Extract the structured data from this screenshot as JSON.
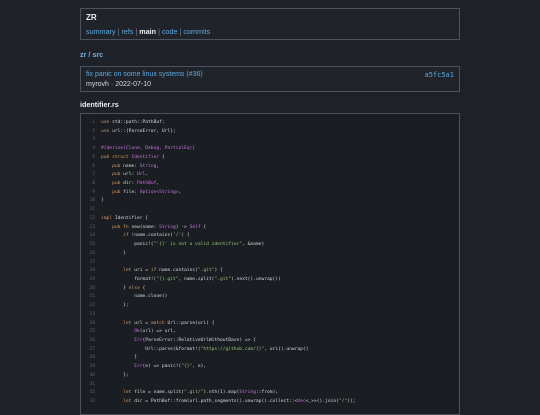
{
  "repo": {
    "name": "ZR",
    "nav": [
      {
        "label": "summary",
        "active": false
      },
      {
        "label": "refs",
        "active": false
      },
      {
        "label": "main",
        "active": true
      },
      {
        "label": "code",
        "active": false
      },
      {
        "label": "commits",
        "active": false
      }
    ],
    "nav_separator": " | "
  },
  "breadcrumb": "zr / src",
  "commit": {
    "message": "fix panic on some linux systems (#36)",
    "author": "myrovh",
    "date": "2022-07-10",
    "separator": " · ",
    "hash": "a5fc5a1"
  },
  "file": {
    "name": "identifier.rs",
    "lines": [
      [
        [
          "kw",
          "use "
        ],
        [
          "txt",
          "std::path::PathBuf;"
        ]
      ],
      [
        [
          "kw",
          "use "
        ],
        [
          "txt",
          "url::{ParseError, Url};"
        ]
      ],
      [],
      [
        [
          "attr",
          "#[derive(Clone, Debug, PartialEq)]"
        ]
      ],
      [
        [
          "kw",
          "pub struct "
        ],
        [
          "ty",
          "Identifier"
        ],
        [
          "txt",
          " {"
        ]
      ],
      [
        [
          "txt",
          "    "
        ],
        [
          "kw",
          "pub "
        ],
        [
          "txt",
          "name: "
        ],
        [
          "ty",
          "String"
        ],
        [
          "txt",
          ","
        ]
      ],
      [
        [
          "txt",
          "    "
        ],
        [
          "kw",
          "pub "
        ],
        [
          "txt",
          "url: "
        ],
        [
          "ty",
          "Url"
        ],
        [
          "txt",
          ","
        ]
      ],
      [
        [
          "txt",
          "    "
        ],
        [
          "kw",
          "pub "
        ],
        [
          "txt",
          "dir: "
        ],
        [
          "ty",
          "PathBuf"
        ],
        [
          "txt",
          ","
        ]
      ],
      [
        [
          "txt",
          "    "
        ],
        [
          "kw",
          "pub "
        ],
        [
          "txt",
          "file: "
        ],
        [
          "ty",
          "Option<String>"
        ],
        [
          "txt",
          ","
        ]
      ],
      [
        [
          "txt",
          "}"
        ]
      ],
      [],
      [
        [
          "kw",
          "impl "
        ],
        [
          "txt",
          "Identifier {"
        ]
      ],
      [
        [
          "txt",
          "    "
        ],
        [
          "kw",
          "pub fn "
        ],
        [
          "txt",
          "new(name: "
        ],
        [
          "ty",
          "String"
        ],
        [
          "txt",
          ") -> "
        ],
        [
          "ty",
          "Self"
        ],
        [
          "txt",
          " {"
        ]
      ],
      [
        [
          "txt",
          "        "
        ],
        [
          "kw",
          "if "
        ],
        [
          "txt",
          "!name.contains("
        ],
        [
          "str",
          "'/'"
        ],
        [
          "txt",
          ") {"
        ]
      ],
      [
        [
          "txt",
          "            panic!("
        ],
        [
          "str",
          "\"'{}' is not a valid identifier\""
        ],
        [
          "txt",
          ", &name)"
        ]
      ],
      [
        [
          "txt",
          "        }"
        ]
      ],
      [],
      [
        [
          "txt",
          "        "
        ],
        [
          "kw",
          "let "
        ],
        [
          "txt",
          "uri = "
        ],
        [
          "kw",
          "if "
        ],
        [
          "txt",
          "name.contains("
        ],
        [
          "str",
          "\".git\""
        ],
        [
          "txt",
          ") {"
        ]
      ],
      [
        [
          "txt",
          "            format!("
        ],
        [
          "str",
          "\"{}.git\""
        ],
        [
          "txt",
          ", name.split("
        ],
        [
          "str",
          "\".git\""
        ],
        [
          "txt",
          ").next().unwrap())"
        ]
      ],
      [
        [
          "txt",
          "        } "
        ],
        [
          "kw",
          "else "
        ],
        [
          "txt",
          "{"
        ]
      ],
      [
        [
          "txt",
          "            name.clone()"
        ]
      ],
      [
        [
          "txt",
          "        };"
        ]
      ],
      [],
      [
        [
          "txt",
          "        "
        ],
        [
          "kw",
          "let "
        ],
        [
          "txt",
          "url = "
        ],
        [
          "kw",
          "match "
        ],
        [
          "txt",
          "Url::parse(uri) {"
        ]
      ],
      [
        [
          "txt",
          "            "
        ],
        [
          "ty",
          "Ok"
        ],
        [
          "txt",
          "(url) => url,"
        ]
      ],
      [
        [
          "txt",
          "            "
        ],
        [
          "ty",
          "Err"
        ],
        [
          "txt",
          "(ParseError::RelativeUrlWithoutBase) => {"
        ]
      ],
      [
        [
          "txt",
          "                Url::parse(&format!("
        ],
        [
          "str",
          "\"https://github.com/{}\""
        ],
        [
          "txt",
          ", uri)).unwrap()"
        ]
      ],
      [
        [
          "txt",
          "            }"
        ]
      ],
      [
        [
          "txt",
          "            "
        ],
        [
          "ty",
          "Err"
        ],
        [
          "txt",
          "(e) => panic!("
        ],
        [
          "str",
          "\"{}\""
        ],
        [
          "txt",
          ", e),"
        ]
      ],
      [
        [
          "txt",
          "        };"
        ]
      ],
      [],
      [
        [
          "txt",
          "        "
        ],
        [
          "kw",
          "let "
        ],
        [
          "txt",
          "file = name.split("
        ],
        [
          "str",
          "\".git/\""
        ],
        [
          "txt",
          ").nth(1).map("
        ],
        [
          "ty",
          "String"
        ],
        [
          "txt",
          "::from);"
        ]
      ],
      [
        [
          "txt",
          "        "
        ],
        [
          "kw",
          "let "
        ],
        [
          "txt",
          "dir = PathBuf::from(url.path_segments().unwrap().collect::<"
        ],
        [
          "ty",
          "Vec"
        ],
        [
          "txt",
          "<_>>().join("
        ],
        [
          "str",
          "\"/\""
        ],
        [
          "txt",
          "));"
        ]
      ]
    ]
  },
  "colors": {
    "background": "#1e2127",
    "link": "#5ca9e0",
    "keyword": "#d19a66",
    "type": "#c678dd",
    "string": "#98c379"
  }
}
